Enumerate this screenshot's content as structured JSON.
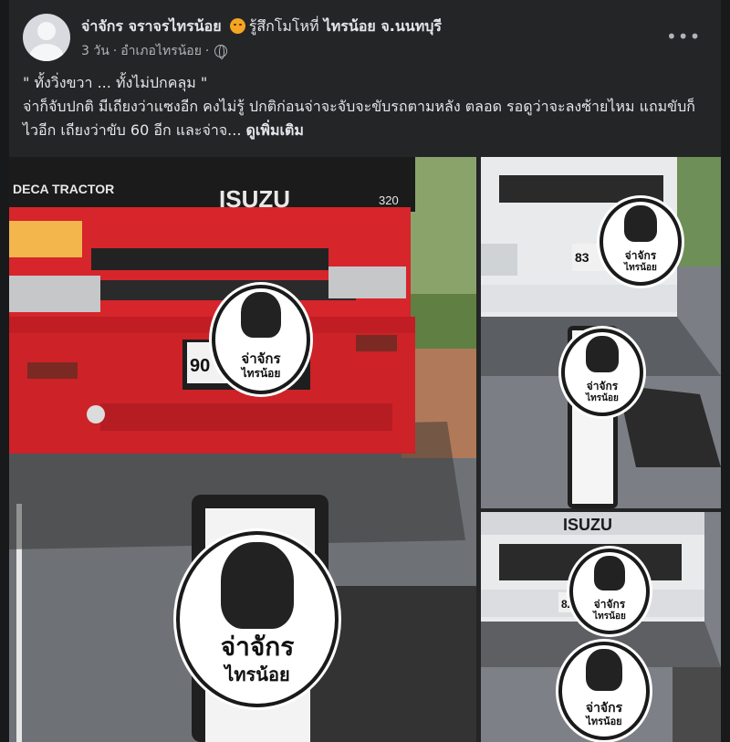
{
  "post": {
    "author": "จ่าจักร จราจรไทรน้อย",
    "feeling_prefix": "รู้สึกโมโหที่",
    "location": "ไทรน้อย จ.นนทบุรี",
    "feeling_icon": "angry-emoji-icon",
    "time": "3 วัน",
    "separator": "·",
    "place": "อำเภอไทรน้อย",
    "privacy_icon": "globe-icon",
    "more_label": "•••",
    "title_line": "\" ทั้งวิ่งขวา ... ทั้งไม่ปกคลุม \"",
    "body_text": "จ่าก็จับปกติ มีเถียงว่าแซงอีก คงไม่รู้ ปกติก่อนจ่าจะจับจะขับรถตามหลัง ตลอด รอดูว่าจะลงซ้ายไหม แถมขับก็ไวอีก เถียงว่าขับ 60 อีก และจ่าจ...",
    "see_more": "ดูเพิ่มเติม"
  },
  "photos": {
    "main": {
      "truck_brand": "ISUZU",
      "truck_model": "320",
      "grille_text": "DECA TRACTOR",
      "plate": "90",
      "sticker_text_1": "จ่าจักร",
      "sticker_text_2": "ไทรน้อย"
    },
    "top_right": {
      "plate": "83",
      "sticker_text_1": "จ่าจักร",
      "sticker_text_2": "ไทรน้อย"
    },
    "bottom_right": {
      "truck_brand": "ISUZU",
      "plate": "82",
      "sticker_text_1": "จ่าจักร",
      "sticker_text_2": "ไทรน้อย"
    }
  },
  "colors": {
    "background": "#18191a",
    "card": "#242526",
    "text": "#e4e6eb",
    "muted": "#b0b3b8",
    "truck_red": "#d6252b",
    "truck_white": "#e9eaec"
  }
}
